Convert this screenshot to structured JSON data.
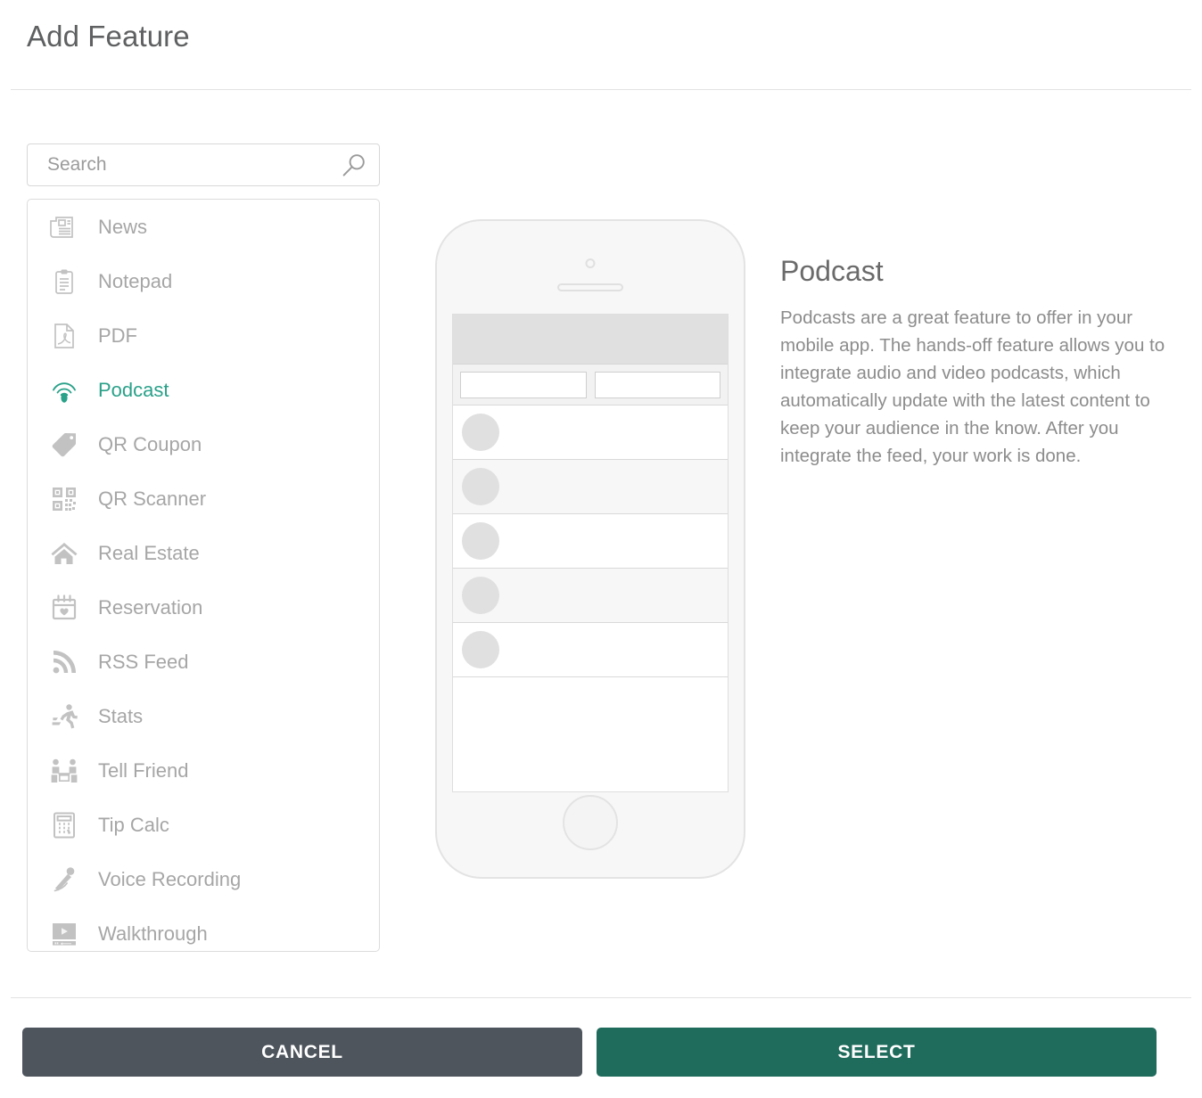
{
  "dialog": {
    "title": "Add Feature"
  },
  "search": {
    "placeholder": "Search",
    "value": "",
    "icon": "search-icon"
  },
  "feature_list": {
    "selected": "Podcast",
    "items": [
      {
        "label": "News",
        "icon": "newspaper-icon",
        "selected": false
      },
      {
        "label": "Notepad",
        "icon": "clipboard-icon",
        "selected": false
      },
      {
        "label": "PDF",
        "icon": "pdf-document-icon",
        "selected": false
      },
      {
        "label": "Podcast",
        "icon": "podcast-icon",
        "selected": true
      },
      {
        "label": "QR Coupon",
        "icon": "tag-icon",
        "selected": false
      },
      {
        "label": "QR Scanner",
        "icon": "qr-code-icon",
        "selected": false
      },
      {
        "label": "Real Estate",
        "icon": "house-icon",
        "selected": false
      },
      {
        "label": "Reservation",
        "icon": "calendar-heart-icon",
        "selected": false
      },
      {
        "label": "RSS Feed",
        "icon": "rss-icon",
        "selected": false
      },
      {
        "label": "Stats",
        "icon": "runner-icon",
        "selected": false
      },
      {
        "label": "Tell Friend",
        "icon": "two-people-icon",
        "selected": false
      },
      {
        "label": "Tip Calc",
        "icon": "calculator-icon",
        "selected": false
      },
      {
        "label": "Voice Recording",
        "icon": "microphone-icon",
        "selected": false
      },
      {
        "label": "Walkthrough",
        "icon": "video-player-icon",
        "selected": false
      }
    ]
  },
  "preview": {
    "device": "iphone-mockup",
    "rows": [
      {
        "style": "white"
      },
      {
        "style": "alt"
      },
      {
        "style": "white"
      },
      {
        "style": "alt"
      },
      {
        "style": "white"
      }
    ]
  },
  "description": {
    "title": "Podcast",
    "body": "Podcasts are a great feature to offer in your mobile app. The hands-off feature allows you to integrate audio and video podcasts, which automatically update with the latest content to keep your audience in the know. After you integrate the feed, your work is done."
  },
  "footer": {
    "cancel_label": "CANCEL",
    "select_label": "SELECT"
  },
  "colors": {
    "accent_green": "#2aa189",
    "select_button": "#1f6b5c",
    "cancel_button": "#4e555d",
    "text_gray": "#a6a6a6",
    "title_gray": "#5f6061"
  }
}
